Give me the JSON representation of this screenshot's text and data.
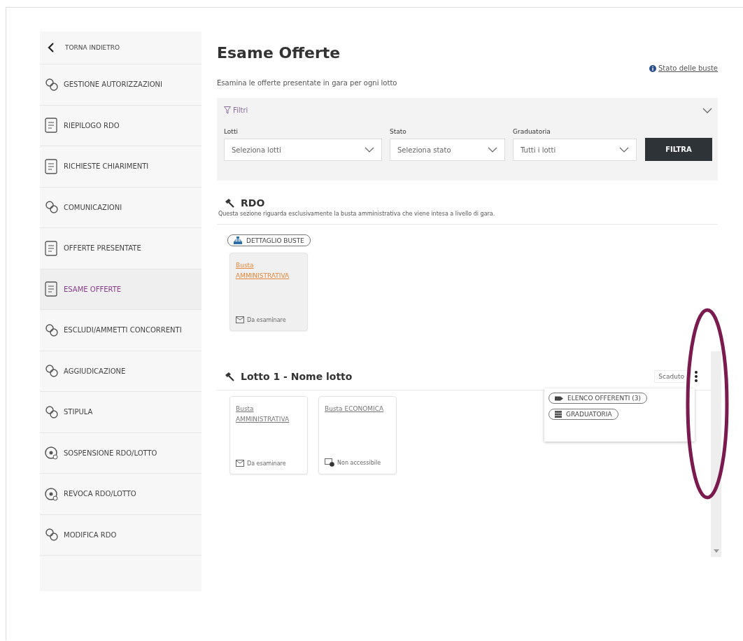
{
  "sidebar": {
    "back": "TORNA INDIETRO",
    "items": [
      {
        "label": "GESTIONE AUTORIZZAZIONI",
        "selected": false
      },
      {
        "label": "RIEPILOGO RDO",
        "selected": false
      },
      {
        "label": "RICHIESTE CHIARIMENTI",
        "selected": false
      },
      {
        "label": "COMUNICAZIONI",
        "selected": false
      },
      {
        "label": "OFFERTE PRESENTATE",
        "selected": false
      },
      {
        "label": "ESAME OFFERTE",
        "selected": true
      },
      {
        "label": "ESCLUDI/AMMETTI CONCORRENTI",
        "selected": false
      },
      {
        "label": "AGGIUDICAZIONE",
        "selected": false
      },
      {
        "label": "STIPULA",
        "selected": false
      },
      {
        "label": "SOSPENSIONE RDO/LOTTO",
        "selected": false
      },
      {
        "label": "REVOCA RDO/LOTTO",
        "selected": false
      },
      {
        "label": "MODIFICA RDO",
        "selected": false
      }
    ]
  },
  "page": {
    "title": "Esame Offerte",
    "info_link": "Stato delle buste",
    "subtitle": "Esamina le offerte presentate in gara per ogni lotto"
  },
  "filters": {
    "title": "Filtri",
    "expanded": true,
    "fields": [
      {
        "label": "Lotti",
        "placeholder": "Seleziona lotti"
      },
      {
        "label": "Stato",
        "placeholder": "Seleziona stato"
      },
      {
        "label": "Graduatoria",
        "placeholder": "Tutti i lotti"
      }
    ],
    "button": "FILTRA"
  },
  "sections": [
    {
      "title": "RDO",
      "description": "Questa sezione riguarda esclusivamente la busta amministrativa che viene intesa a livello di gara.",
      "detail_button": "DETTAGLIO BUSTE",
      "cards": [
        {
          "title": "Busta AMMINISTRATIVA",
          "selected": true,
          "status": "Da esaminare",
          "kind": "envelope"
        }
      ]
    },
    {
      "title": "Lotto 1 - Nome lotto",
      "badge": "Scaduto",
      "cards": [
        {
          "title": "Busta AMMINISTRATIVA",
          "selected": false,
          "status": "Da esaminare",
          "kind": "envelope"
        },
        {
          "title": "Busta ECONOMICA",
          "selected": false,
          "status": "Non accessibile",
          "kind": "locked"
        }
      ],
      "menu": {
        "open": true,
        "items": [
          {
            "label": "ELENCO OFFERENTI (3)",
            "kind": "tag"
          },
          {
            "label": "GRADUATORIA",
            "kind": "list"
          }
        ]
      }
    }
  ]
}
